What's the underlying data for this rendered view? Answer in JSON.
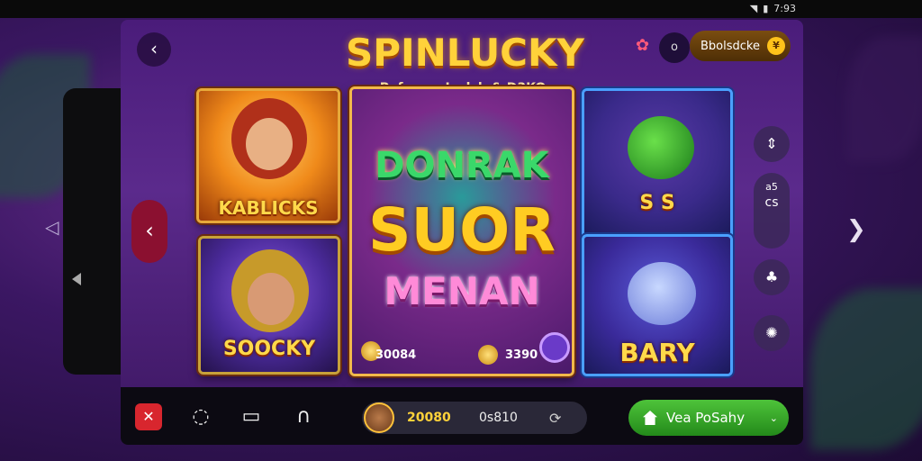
{
  "status_bar": {
    "time": "7:93"
  },
  "header": {
    "title": "SPINLUCKY",
    "subtitle": "Pefesom Ioslsh & D3KO",
    "notifications_badge": "o",
    "balance_label": "Bbolsdcke",
    "balance_coin": "¥"
  },
  "cards": [
    {
      "id": "kablicks",
      "label": "KABLICKS"
    },
    {
      "id": "soocky",
      "label": "SOOCKY"
    },
    {
      "id": "feature",
      "line1": "DONRAK",
      "line2": "SUOR",
      "line3": "MENAN",
      "left_value": "30084",
      "right_value": "3390"
    },
    {
      "id": "dragon",
      "label": "S  S"
    },
    {
      "id": "bary",
      "label": "BARY"
    }
  ],
  "side_panel": {
    "mid_label_top": "a5",
    "mid_label_bottom": "cs"
  },
  "bottom_bar": {
    "bet_amount": "20080",
    "bet_count": "0s810",
    "cta_label": "Vea PoSahy"
  },
  "colors": {
    "brand_gold": "#ffd23a",
    "cta_green": "#3aa82a",
    "nav_red": "#d8262e"
  }
}
